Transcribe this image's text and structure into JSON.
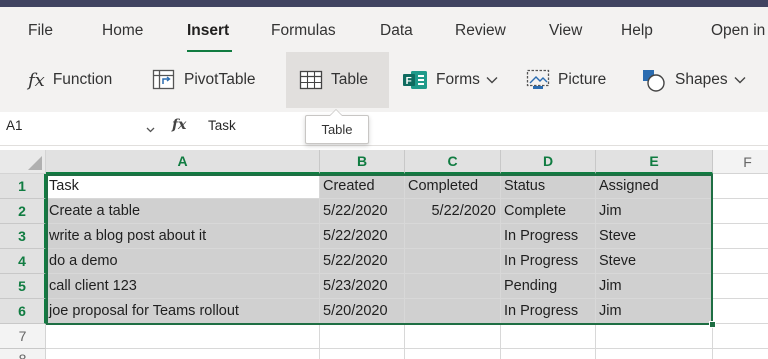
{
  "menu": {
    "tabs": [
      "File",
      "Home",
      "Insert",
      "Formulas",
      "Data",
      "Review",
      "View",
      "Help",
      "Open in"
    ],
    "active": "Insert"
  },
  "ribbon": {
    "function_label": "Function",
    "pivottable_label": "PivotTable",
    "table_label": "Table",
    "forms_label": "Forms",
    "picture_label": "Picture",
    "shapes_label": "Shapes"
  },
  "formula_bar": {
    "name_box": "A1",
    "fx": "fx",
    "value": "Task"
  },
  "tooltip": {
    "text": "Table"
  },
  "grid": {
    "columns": [
      "A",
      "B",
      "C",
      "D",
      "E",
      "F"
    ],
    "rows": [
      "1",
      "2",
      "3",
      "4",
      "5",
      "6",
      "7",
      "8"
    ],
    "cells": [
      [
        "Task",
        "Created",
        "Completed",
        "Status",
        "Assigned"
      ],
      [
        "Create a table",
        "5/22/2020",
        "5/22/2020",
        "Complete",
        "Jim"
      ],
      [
        "write a blog post about it",
        "5/22/2020",
        "",
        "In Progress",
        "Steve"
      ],
      [
        "do a demo",
        "5/22/2020",
        "",
        "In Progress",
        "Steve"
      ],
      [
        "call client 123",
        "5/23/2020",
        "",
        "Pending",
        "Jim"
      ],
      [
        "joe proposal for Teams rollout",
        "5/20/2020",
        "",
        "In Progress",
        "Jim"
      ]
    ]
  },
  "colors": {
    "accent": "#107c41",
    "topbar": "#404461",
    "ribbon_bg": "#f3f2f1",
    "selection_fill": "#d0d0d0"
  }
}
